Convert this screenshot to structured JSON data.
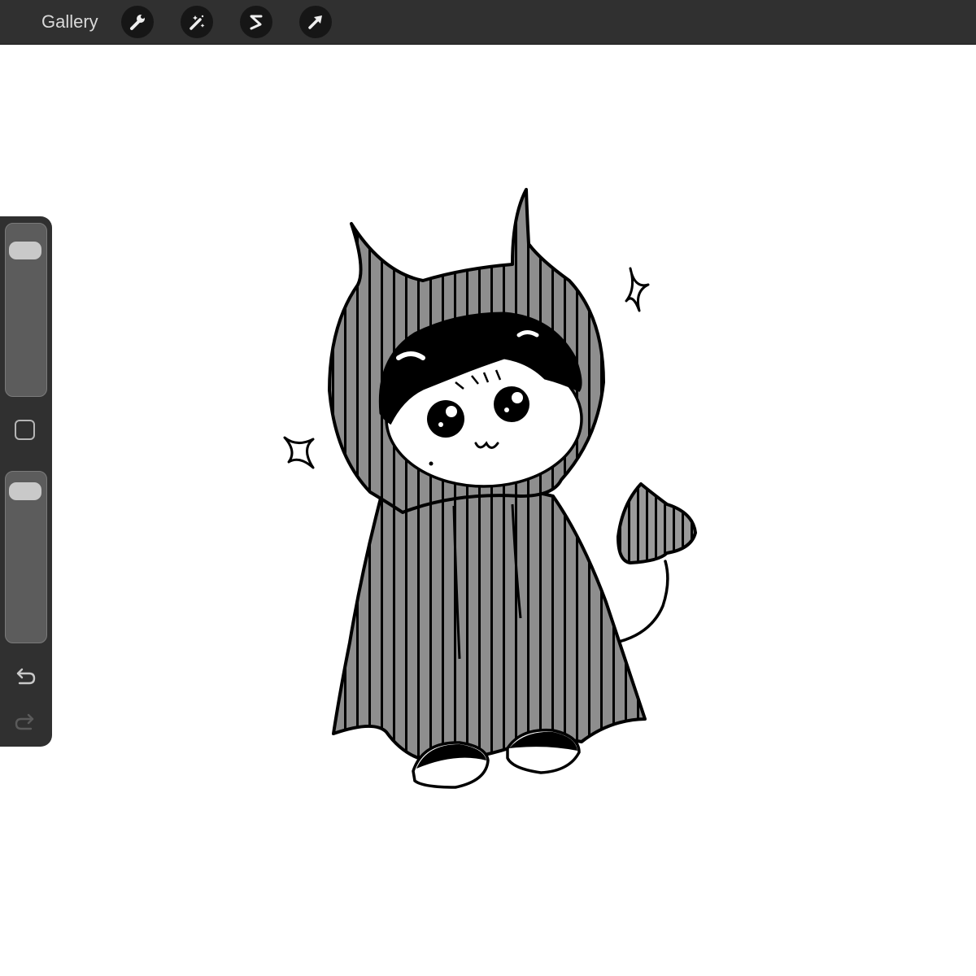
{
  "toolbar": {
    "gallery_label": "Gallery",
    "tools": [
      {
        "name": "actions",
        "icon": "wrench-icon"
      },
      {
        "name": "adjustments",
        "icon": "magic-wand-icon"
      },
      {
        "name": "selection",
        "icon": "selection-s-icon"
      },
      {
        "name": "transform",
        "icon": "arrow-cursor-icon"
      }
    ]
  },
  "sidebar": {
    "brush_size_level": 0.1,
    "opacity_level": 0.05,
    "modify_icon": "square-icon",
    "undo_icon": "undo-arrow-icon",
    "redo_icon": "redo-arrow-icon",
    "redo_enabled": false
  },
  "canvas": {
    "background": "#ffffff",
    "ink": "#000000",
    "fill": "#8e8e8e"
  }
}
